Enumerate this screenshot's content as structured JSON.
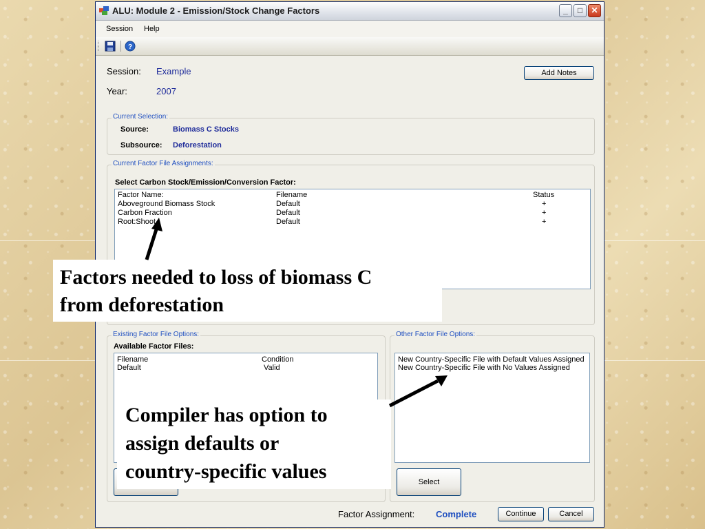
{
  "window": {
    "title": "ALU: Module 2 - Emission/Stock Change Factors",
    "controls": {
      "minimize": "_",
      "maximize": "□",
      "close": "✕"
    }
  },
  "menu": [
    "Session",
    "Help"
  ],
  "toolbar_icons": [
    "save-icon",
    "help-icon"
  ],
  "session": {
    "label": "Session:",
    "value": "Example"
  },
  "year": {
    "label": "Year:",
    "value": "2007"
  },
  "add_notes_label": "Add Notes",
  "current_selection": {
    "legend": "Current Selection:",
    "source_label": "Source:",
    "source_value": "Biomass C Stocks",
    "subsource_label": "Subsource:",
    "subsource_value": "Deforestation"
  },
  "factor_assignments": {
    "legend": "Current Factor File Assignments:",
    "heading": "Select Carbon Stock/Emission/Conversion Factor:",
    "columns": [
      "Factor Name:",
      "Filename",
      "Status"
    ],
    "rows": [
      [
        "Aboveground Biomass Stock",
        "Default",
        "+"
      ],
      [
        "Carbon Fraction",
        "Default",
        "+"
      ],
      [
        "Root:Shoot",
        "Default",
        "+"
      ]
    ]
  },
  "existing_options": {
    "legend": "Existing Factor File Options:",
    "heading": "Available Factor Files:",
    "columns": [
      "Filename",
      "Condition"
    ],
    "rows": [
      [
        "Default",
        "Valid"
      ]
    ]
  },
  "other_options": {
    "legend": "Other Factor File Options:",
    "items": [
      "New Country-Specific File with Default Values Assigned",
      "New Country-Specific File with No Values Assigned"
    ],
    "select_label": "Select"
  },
  "status": {
    "label": "Factor Assignment:",
    "value": "Complete"
  },
  "continue_label": "Continue",
  "cancel_label": "Cancel",
  "callouts": {
    "factors": [
      "Factors needed to loss of biomass C",
      "from deforestation"
    ],
    "compiler": [
      "Compiler has option to",
      "assign defaults or",
      "country-specific values"
    ]
  },
  "colors": {
    "accent_blue": "#1e2b9a",
    "legend_blue": "#1f4fc0",
    "titlebar": "#dfe3ea"
  }
}
